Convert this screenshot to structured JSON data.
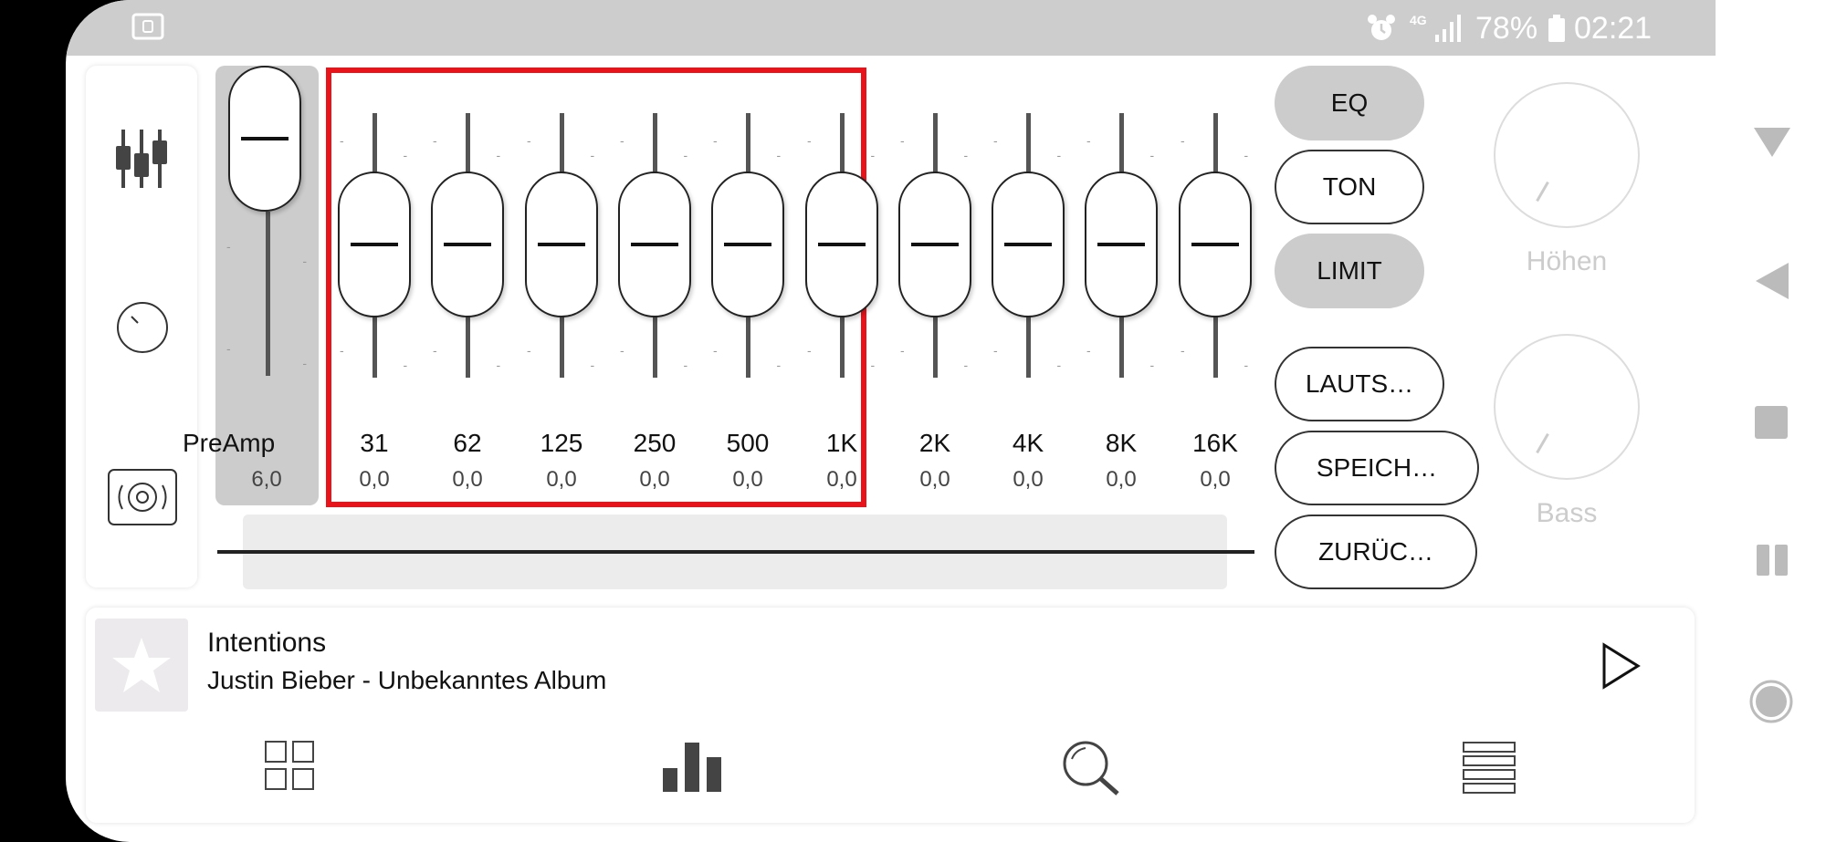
{
  "status_bar": {
    "battery_percent": "78%",
    "time": "02:21",
    "network": "4G"
  },
  "side_menu": {
    "items": [
      {
        "name": "equalizer-icon"
      },
      {
        "name": "knob-icon"
      },
      {
        "name": "speaker-icon"
      }
    ]
  },
  "equalizer": {
    "preamp": {
      "label": "PreAmp",
      "value": "6,0"
    },
    "bands": [
      {
        "label": "31",
        "value": "0,0"
      },
      {
        "label": "62",
        "value": "0,0"
      },
      {
        "label": "125",
        "value": "0,0"
      },
      {
        "label": "250",
        "value": "0,0"
      },
      {
        "label": "500",
        "value": "0,0"
      },
      {
        "label": "1K",
        "value": "0,0"
      },
      {
        "label": "2K",
        "value": "0,0"
      },
      {
        "label": "4K",
        "value": "0,0"
      },
      {
        "label": "8K",
        "value": "0,0"
      },
      {
        "label": "16K",
        "value": "0,0"
      }
    ],
    "highlight_color": "#e8141b"
  },
  "buttons": {
    "eq": "EQ",
    "ton": "TON",
    "limit": "LIMIT",
    "lauts": "LAUTS…",
    "speich": "SPEICH…",
    "zuruc": "ZURÜC…"
  },
  "dials": {
    "treble": "Höhen",
    "bass": "Bass"
  },
  "now_playing": {
    "title": "Intentions",
    "subtitle": "Justin Bieber - Unbekanntes Album"
  },
  "bottom_nav": [
    {
      "name": "grid-icon"
    },
    {
      "name": "bar-chart-icon"
    },
    {
      "name": "search-icon"
    },
    {
      "name": "list-icon"
    }
  ]
}
